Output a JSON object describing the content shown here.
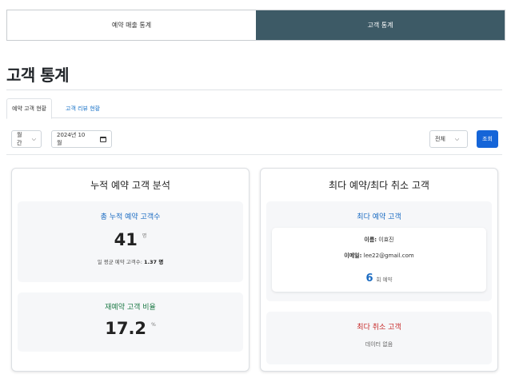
{
  "top_tabs": [
    {
      "label": "예약 매출 통계",
      "active": false
    },
    {
      "label": "고객 통계",
      "active": true
    }
  ],
  "page_title": "고객 통계",
  "sub_tabs": [
    {
      "label": "예약 고객 현황",
      "active": true
    },
    {
      "label": "고객 리뷰 현황",
      "active": false
    }
  ],
  "filters": {
    "period": "월간",
    "month": "2024년 10월",
    "scope": "전체",
    "search_label": "조회"
  },
  "accumulated": {
    "title": "누적 예약 고객 분석",
    "total_label": "총 누적 예약 고객수",
    "total_value": "41",
    "total_unit": "명",
    "daily_avg_label": "일 평균 예약 고객수:",
    "daily_avg_value": "1.37 명",
    "rebook_label": "재예약 고객 비율",
    "rebook_value": "17.2",
    "rebook_unit": "%"
  },
  "top_customers": {
    "title": "최다 예약/최다 취소 고객",
    "most_booked_label": "최다 예약 고객",
    "name_label": "이름:",
    "name_value": "이효진",
    "email_label": "이메일:",
    "email_value": "lee22@gmail.com",
    "count_value": "6",
    "count_unit": "회 예약",
    "most_cancelled_label": "최다 취소 고객",
    "no_data": "데이터 없음"
  },
  "colors": {
    "active_tab_bg": "#3d5a66",
    "search_button": "#1565d8",
    "accent_blue": "#1a6bc2",
    "accent_green": "#1d7a46",
    "accent_red": "#c62828"
  }
}
